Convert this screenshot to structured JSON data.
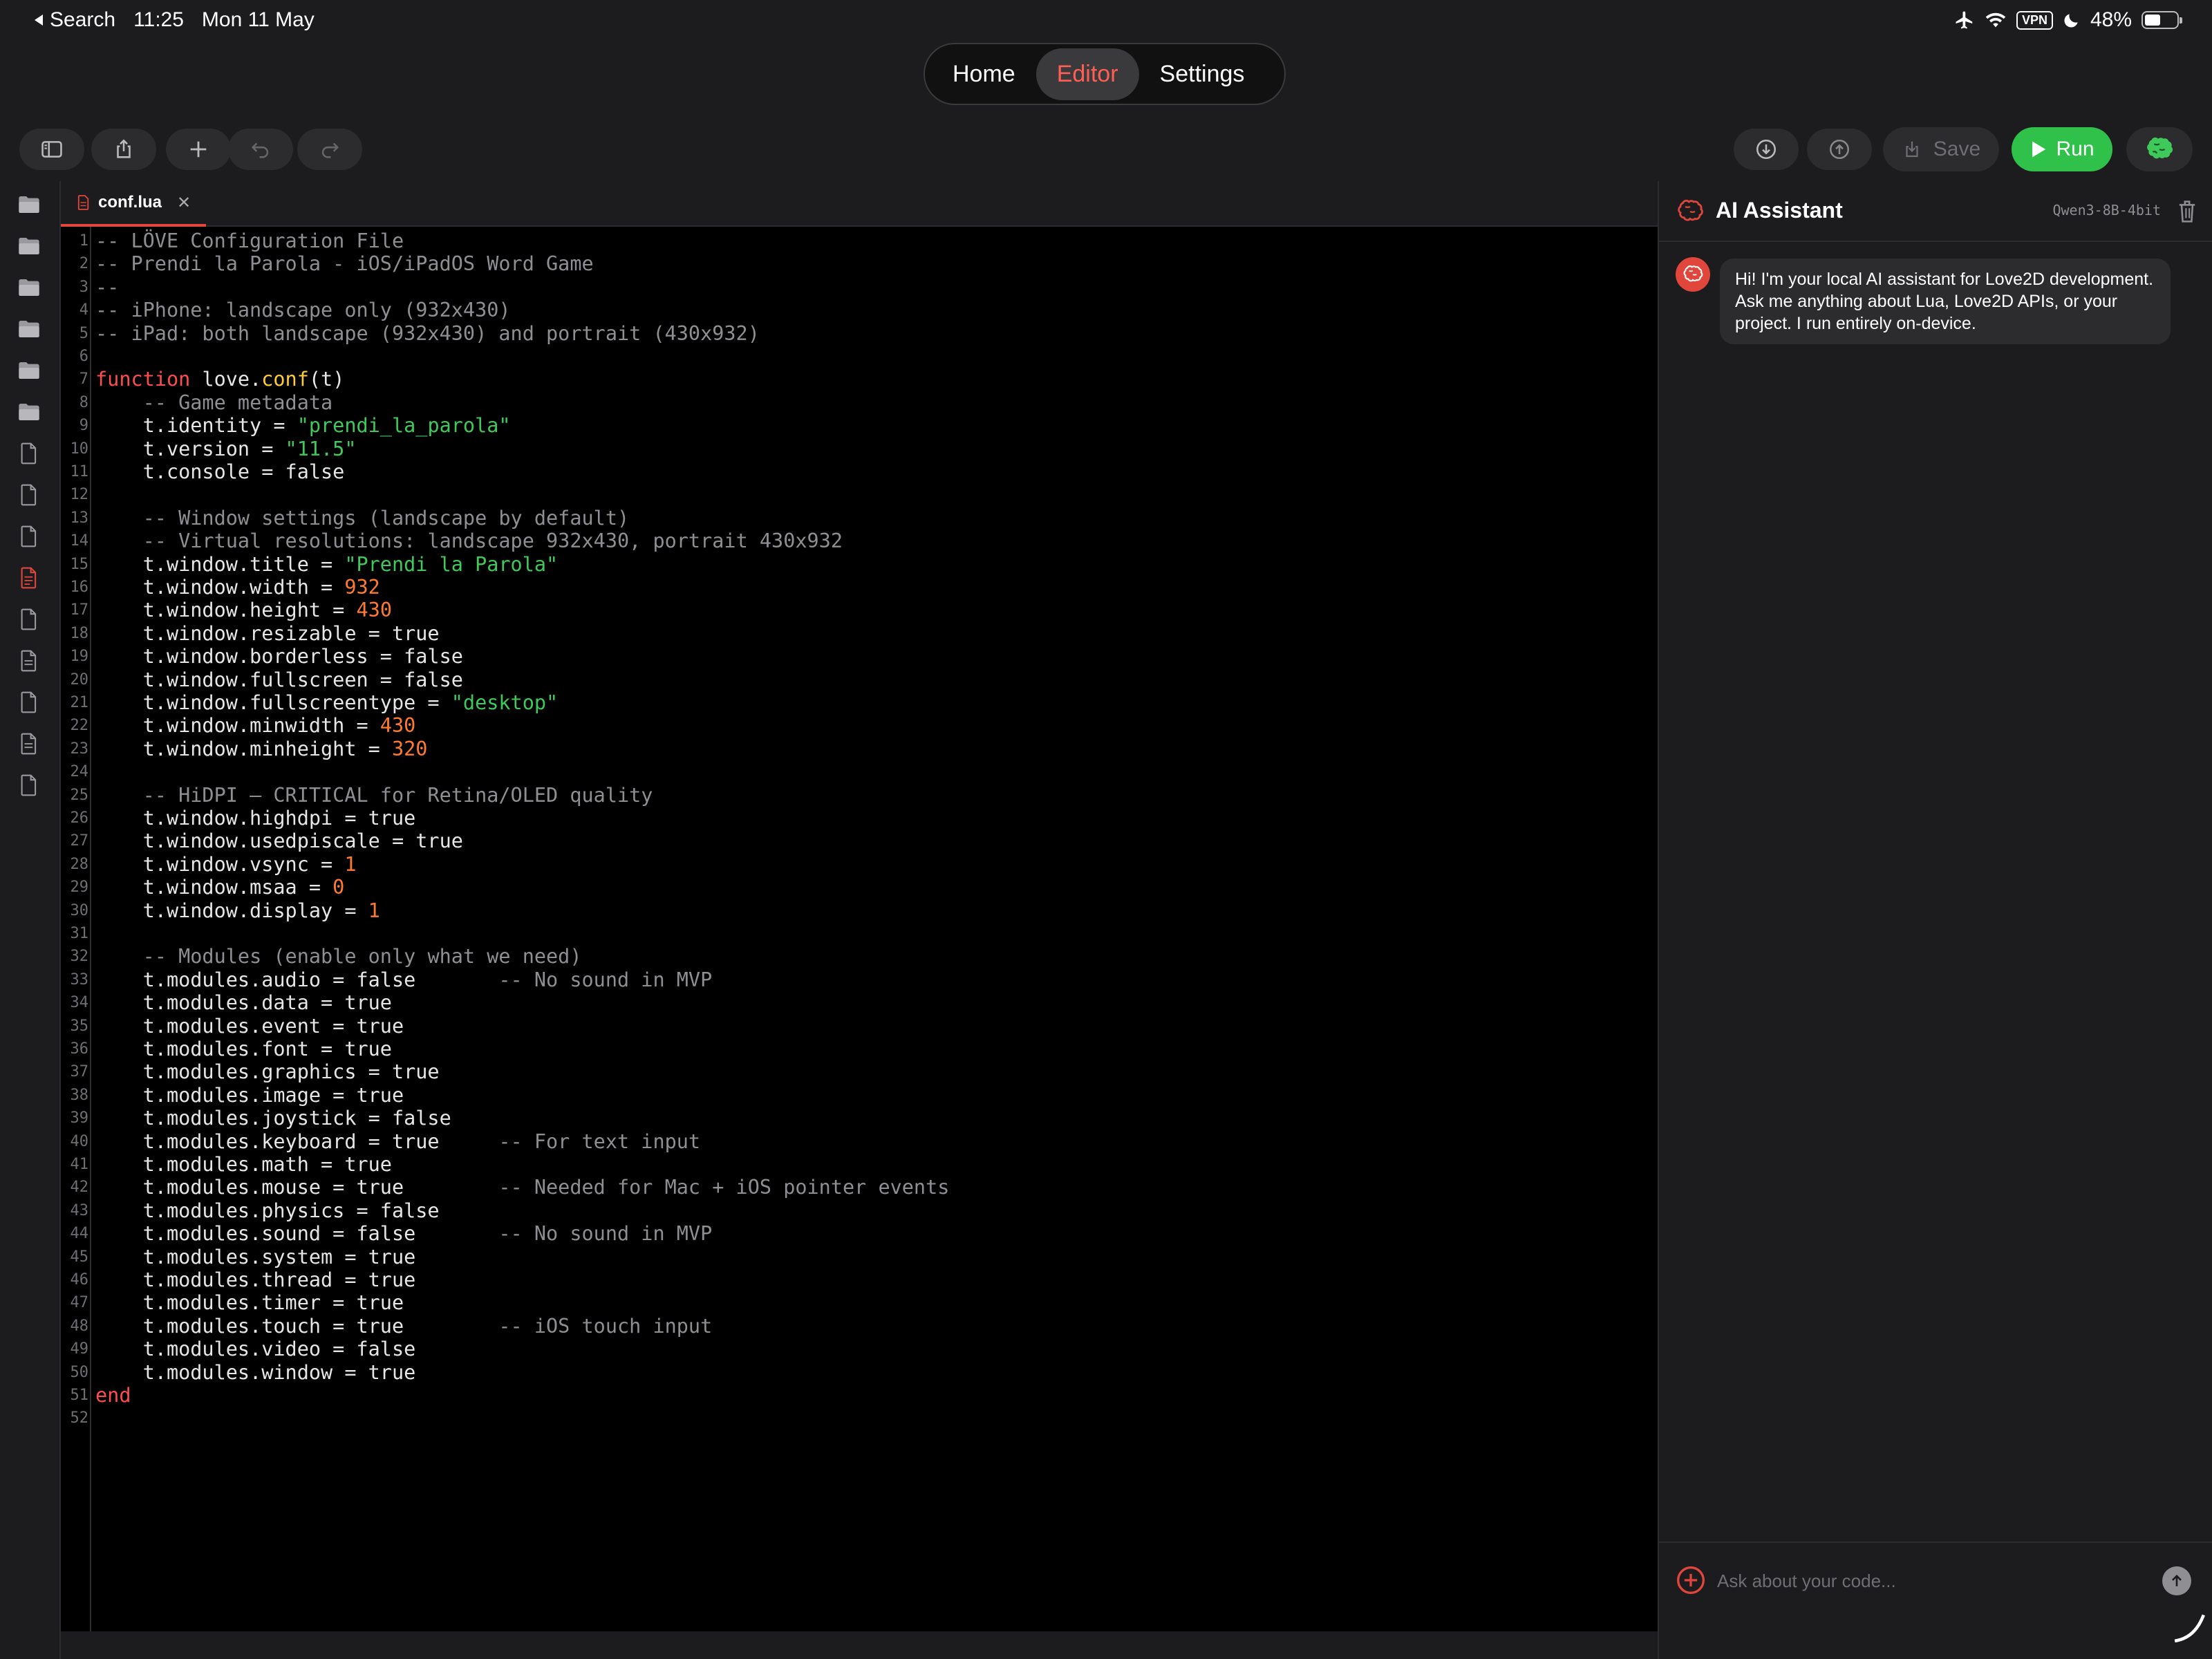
{
  "status_bar": {
    "back_label": "Search",
    "time": "11:25",
    "date": "Mon 11 May",
    "vpn": "VPN",
    "battery_percent": "48%"
  },
  "nav": {
    "tabs": [
      {
        "label": "Home",
        "active": false
      },
      {
        "label": "Editor",
        "active": true
      },
      {
        "label": "Settings",
        "active": false
      }
    ]
  },
  "toolbar": {
    "save_label": "Save",
    "run_label": "Run"
  },
  "sidebar": {
    "items": [
      "folder-icon",
      "folder-icon",
      "folder-icon",
      "folder-icon",
      "folder-icon",
      "folder-icon",
      "file-icon",
      "file-icon",
      "file-icon",
      "lua-file-icon-active",
      "file-icon",
      "file-text-icon",
      "file-icon",
      "file-text-icon",
      "file-icon"
    ]
  },
  "editor": {
    "tab_name": "conf.lua",
    "lines": [
      "-- LÖVE Configuration File",
      "-- Prendi la Parola - iOS/iPadOS Word Game",
      "--",
      "-- iPhone: landscape only (932x430)",
      "-- iPad: both landscape (932x430) and portrait (430x932)",
      "",
      "function love.conf(t)",
      "    -- Game metadata",
      "    t.identity = \"prendi_la_parola\"",
      "    t.version = \"11.5\"",
      "    t.console = false",
      "",
      "    -- Window settings (landscape by default)",
      "    -- Virtual resolutions: landscape 932x430, portrait 430x932",
      "    t.window.title = \"Prendi la Parola\"",
      "    t.window.width = 932",
      "    t.window.height = 430",
      "    t.window.resizable = true",
      "    t.window.borderless = false",
      "    t.window.fullscreen = false",
      "    t.window.fullscreentype = \"desktop\"",
      "    t.window.minwidth = 430",
      "    t.window.minheight = 320",
      "",
      "    -- HiDPI — CRITICAL for Retina/OLED quality",
      "    t.window.highdpi = true",
      "    t.window.usedpiscale = true",
      "    t.window.vsync = 1",
      "    t.window.msaa = 0",
      "    t.window.display = 1",
      "",
      "    -- Modules (enable only what we need)",
      "    t.modules.audio = false       -- No sound in MVP",
      "    t.modules.data = true",
      "    t.modules.event = true",
      "    t.modules.font = true",
      "    t.modules.graphics = true",
      "    t.modules.image = true",
      "    t.modules.joystick = false",
      "    t.modules.keyboard = true     -- For text input",
      "    t.modules.math = true",
      "    t.modules.mouse = true        -- Needed for Mac + iOS pointer events",
      "    t.modules.physics = false",
      "    t.modules.sound = false       -- No sound in MVP",
      "    t.modules.system = true",
      "    t.modules.thread = true",
      "    t.modules.timer = true",
      "    t.modules.touch = true        -- iOS touch input",
      "    t.modules.video = false",
      "    t.modules.window = true",
      "end",
      ""
    ]
  },
  "ai_panel": {
    "title": "AI Assistant",
    "model": "Qwen3-8B-4bit",
    "greeting": "Hi! I'm your local AI assistant for Love2D development. Ask me anything about Lua, Love2D APIs, or your project. I run entirely on-device.",
    "input_placeholder": "Ask about your code..."
  },
  "colors": {
    "accent": "#ff5e54",
    "run": "#30c14a",
    "string": "#3fc95a",
    "number": "#ff7a2e",
    "keyword": "#ff4d4d",
    "function": "#ffcc33",
    "comment": "#8e8e93"
  }
}
